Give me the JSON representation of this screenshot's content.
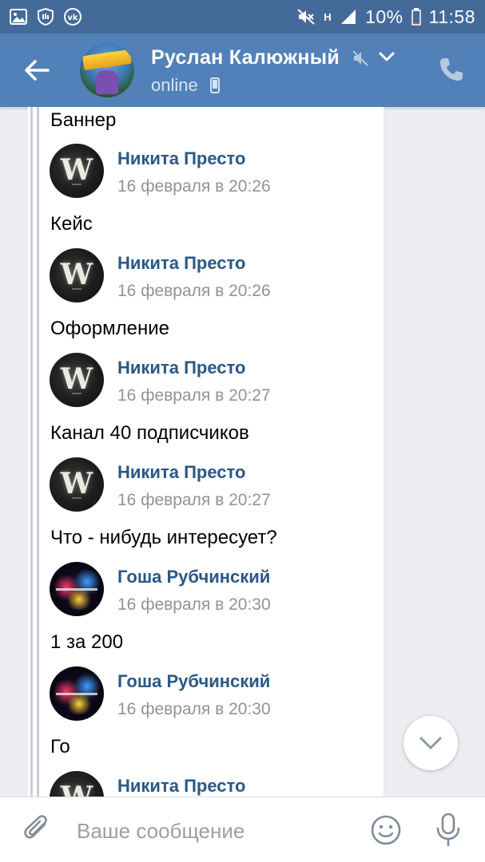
{
  "status_bar": {
    "icons_left": [
      "gallery-icon",
      "hand-shield-icon",
      "vk-app-icon"
    ],
    "net_label": "H",
    "battery": "10%",
    "time": "11:58"
  },
  "header": {
    "contact_name": "Руслан Калюжный",
    "status": "online"
  },
  "messages": [
    {
      "type": "text",
      "text": "Баннер"
    },
    {
      "type": "author",
      "author": "Никита Престо",
      "date": "16 февраля в 20:26",
      "avatar": "w-logo-avatar"
    },
    {
      "type": "text",
      "text": "Кейс"
    },
    {
      "type": "author",
      "author": "Никита Престо",
      "date": "16 февраля в 20:26",
      "avatar": "w-logo-avatar"
    },
    {
      "type": "text",
      "text": "Оформление"
    },
    {
      "type": "author",
      "author": "Никита Престо",
      "date": "16 февраля в 20:27",
      "avatar": "w-logo-avatar"
    },
    {
      "type": "text",
      "text": "Канал 40 подписчиков"
    },
    {
      "type": "author",
      "author": "Никита Престо",
      "date": "16 февраля в 20:27",
      "avatar": "w-logo-avatar"
    },
    {
      "type": "text",
      "text": "Что - нибудь интересует?"
    },
    {
      "type": "author",
      "author": "Гоша Рубчинский",
      "date": "16 февраля в 20:30",
      "avatar": "splash-avatar"
    },
    {
      "type": "text",
      "text": "1 за 200"
    },
    {
      "type": "author",
      "author": "Гоша Рубчинский",
      "date": "16 февраля в 20:30",
      "avatar": "splash-avatar"
    },
    {
      "type": "text",
      "text": "Го"
    },
    {
      "type": "author",
      "author": "Никита Престо",
      "date": "",
      "avatar": "w-logo-avatar"
    }
  ],
  "composer": {
    "placeholder": "Ваше сообщение"
  },
  "colors": {
    "status_bar": "#446a99",
    "header": "#5181b8",
    "author": "#2a5885",
    "date": "#939393",
    "background": "#ebedf0"
  }
}
